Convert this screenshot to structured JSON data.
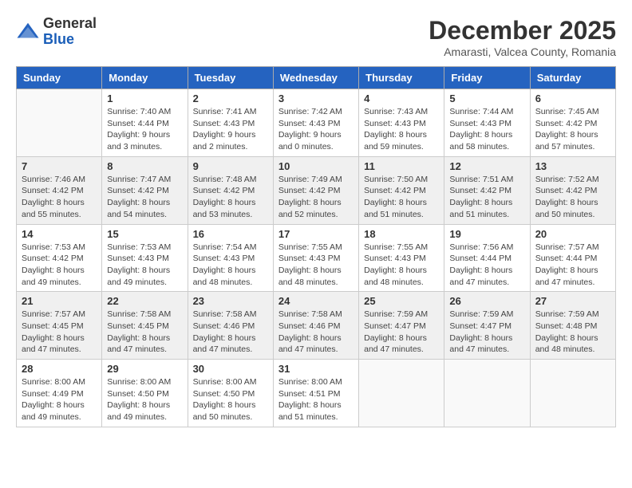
{
  "logo": {
    "general": "General",
    "blue": "Blue"
  },
  "header": {
    "month": "December 2025",
    "location": "Amarasti, Valcea County, Romania"
  },
  "days_of_week": [
    "Sunday",
    "Monday",
    "Tuesday",
    "Wednesday",
    "Thursday",
    "Friday",
    "Saturday"
  ],
  "weeks": [
    [
      {
        "day": "",
        "sunrise": "",
        "sunset": "",
        "daylight": ""
      },
      {
        "day": "1",
        "sunrise": "Sunrise: 7:40 AM",
        "sunset": "Sunset: 4:44 PM",
        "daylight": "Daylight: 9 hours and 3 minutes."
      },
      {
        "day": "2",
        "sunrise": "Sunrise: 7:41 AM",
        "sunset": "Sunset: 4:43 PM",
        "daylight": "Daylight: 9 hours and 2 minutes."
      },
      {
        "day": "3",
        "sunrise": "Sunrise: 7:42 AM",
        "sunset": "Sunset: 4:43 PM",
        "daylight": "Daylight: 9 hours and 0 minutes."
      },
      {
        "day": "4",
        "sunrise": "Sunrise: 7:43 AM",
        "sunset": "Sunset: 4:43 PM",
        "daylight": "Daylight: 8 hours and 59 minutes."
      },
      {
        "day": "5",
        "sunrise": "Sunrise: 7:44 AM",
        "sunset": "Sunset: 4:43 PM",
        "daylight": "Daylight: 8 hours and 58 minutes."
      },
      {
        "day": "6",
        "sunrise": "Sunrise: 7:45 AM",
        "sunset": "Sunset: 4:42 PM",
        "daylight": "Daylight: 8 hours and 57 minutes."
      }
    ],
    [
      {
        "day": "7",
        "sunrise": "Sunrise: 7:46 AM",
        "sunset": "Sunset: 4:42 PM",
        "daylight": "Daylight: 8 hours and 55 minutes."
      },
      {
        "day": "8",
        "sunrise": "Sunrise: 7:47 AM",
        "sunset": "Sunset: 4:42 PM",
        "daylight": "Daylight: 8 hours and 54 minutes."
      },
      {
        "day": "9",
        "sunrise": "Sunrise: 7:48 AM",
        "sunset": "Sunset: 4:42 PM",
        "daylight": "Daylight: 8 hours and 53 minutes."
      },
      {
        "day": "10",
        "sunrise": "Sunrise: 7:49 AM",
        "sunset": "Sunset: 4:42 PM",
        "daylight": "Daylight: 8 hours and 52 minutes."
      },
      {
        "day": "11",
        "sunrise": "Sunrise: 7:50 AM",
        "sunset": "Sunset: 4:42 PM",
        "daylight": "Daylight: 8 hours and 51 minutes."
      },
      {
        "day": "12",
        "sunrise": "Sunrise: 7:51 AM",
        "sunset": "Sunset: 4:42 PM",
        "daylight": "Daylight: 8 hours and 51 minutes."
      },
      {
        "day": "13",
        "sunrise": "Sunrise: 7:52 AM",
        "sunset": "Sunset: 4:42 PM",
        "daylight": "Daylight: 8 hours and 50 minutes."
      }
    ],
    [
      {
        "day": "14",
        "sunrise": "Sunrise: 7:53 AM",
        "sunset": "Sunset: 4:42 PM",
        "daylight": "Daylight: 8 hours and 49 minutes."
      },
      {
        "day": "15",
        "sunrise": "Sunrise: 7:53 AM",
        "sunset": "Sunset: 4:43 PM",
        "daylight": "Daylight: 8 hours and 49 minutes."
      },
      {
        "day": "16",
        "sunrise": "Sunrise: 7:54 AM",
        "sunset": "Sunset: 4:43 PM",
        "daylight": "Daylight: 8 hours and 48 minutes."
      },
      {
        "day": "17",
        "sunrise": "Sunrise: 7:55 AM",
        "sunset": "Sunset: 4:43 PM",
        "daylight": "Daylight: 8 hours and 48 minutes."
      },
      {
        "day": "18",
        "sunrise": "Sunrise: 7:55 AM",
        "sunset": "Sunset: 4:43 PM",
        "daylight": "Daylight: 8 hours and 48 minutes."
      },
      {
        "day": "19",
        "sunrise": "Sunrise: 7:56 AM",
        "sunset": "Sunset: 4:44 PM",
        "daylight": "Daylight: 8 hours and 47 minutes."
      },
      {
        "day": "20",
        "sunrise": "Sunrise: 7:57 AM",
        "sunset": "Sunset: 4:44 PM",
        "daylight": "Daylight: 8 hours and 47 minutes."
      }
    ],
    [
      {
        "day": "21",
        "sunrise": "Sunrise: 7:57 AM",
        "sunset": "Sunset: 4:45 PM",
        "daylight": "Daylight: 8 hours and 47 minutes."
      },
      {
        "day": "22",
        "sunrise": "Sunrise: 7:58 AM",
        "sunset": "Sunset: 4:45 PM",
        "daylight": "Daylight: 8 hours and 47 minutes."
      },
      {
        "day": "23",
        "sunrise": "Sunrise: 7:58 AM",
        "sunset": "Sunset: 4:46 PM",
        "daylight": "Daylight: 8 hours and 47 minutes."
      },
      {
        "day": "24",
        "sunrise": "Sunrise: 7:58 AM",
        "sunset": "Sunset: 4:46 PM",
        "daylight": "Daylight: 8 hours and 47 minutes."
      },
      {
        "day": "25",
        "sunrise": "Sunrise: 7:59 AM",
        "sunset": "Sunset: 4:47 PM",
        "daylight": "Daylight: 8 hours and 47 minutes."
      },
      {
        "day": "26",
        "sunrise": "Sunrise: 7:59 AM",
        "sunset": "Sunset: 4:47 PM",
        "daylight": "Daylight: 8 hours and 47 minutes."
      },
      {
        "day": "27",
        "sunrise": "Sunrise: 7:59 AM",
        "sunset": "Sunset: 4:48 PM",
        "daylight": "Daylight: 8 hours and 48 minutes."
      }
    ],
    [
      {
        "day": "28",
        "sunrise": "Sunrise: 8:00 AM",
        "sunset": "Sunset: 4:49 PM",
        "daylight": "Daylight: 8 hours and 49 minutes."
      },
      {
        "day": "29",
        "sunrise": "Sunrise: 8:00 AM",
        "sunset": "Sunset: 4:50 PM",
        "daylight": "Daylight: 8 hours and 49 minutes."
      },
      {
        "day": "30",
        "sunrise": "Sunrise: 8:00 AM",
        "sunset": "Sunset: 4:50 PM",
        "daylight": "Daylight: 8 hours and 50 minutes."
      },
      {
        "day": "31",
        "sunrise": "Sunrise: 8:00 AM",
        "sunset": "Sunset: 4:51 PM",
        "daylight": "Daylight: 8 hours and 51 minutes."
      },
      {
        "day": "",
        "sunrise": "",
        "sunset": "",
        "daylight": ""
      },
      {
        "day": "",
        "sunrise": "",
        "sunset": "",
        "daylight": ""
      },
      {
        "day": "",
        "sunrise": "",
        "sunset": "",
        "daylight": ""
      }
    ]
  ]
}
